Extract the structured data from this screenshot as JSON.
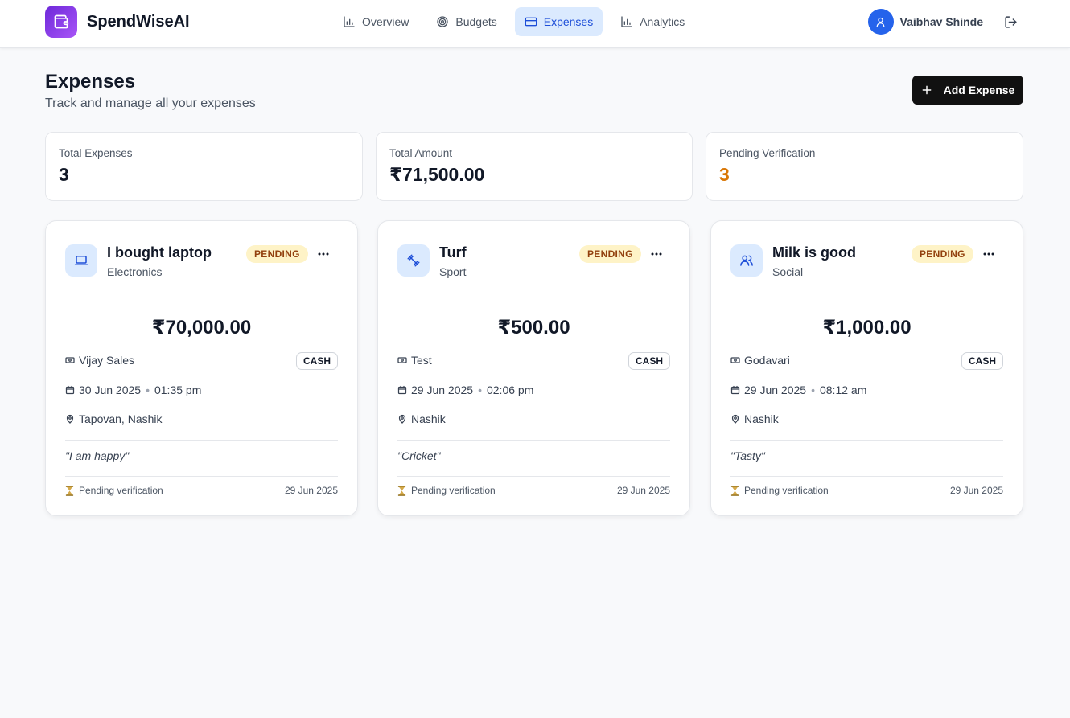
{
  "app": {
    "name": "SpendWiseAI"
  },
  "nav": {
    "items": [
      {
        "label": "Overview",
        "icon": "bar-chart-icon"
      },
      {
        "label": "Budgets",
        "icon": "target-icon"
      },
      {
        "label": "Expenses",
        "icon": "credit-card-icon",
        "active": true
      },
      {
        "label": "Analytics",
        "icon": "bar-chart-icon"
      }
    ]
  },
  "user": {
    "name": "Vaibhav Shinde"
  },
  "header": {
    "title": "Expenses",
    "subtitle": "Track and manage all your expenses",
    "add_button": "Add Expense"
  },
  "stats": [
    {
      "label": "Total Expenses",
      "value": "3"
    },
    {
      "label": "Total Amount",
      "value": "₹71,500.00"
    },
    {
      "label": "Pending Verification",
      "value": "3"
    }
  ],
  "colors": {
    "accent": "#1d4ed8",
    "pending_bg": "#fef3c7",
    "pending_text": "#92400e",
    "warning": "#d97706"
  },
  "expenses": [
    {
      "title": "I bought laptop",
      "category": "Electronics",
      "category_icon": "laptop-icon",
      "status": "PENDING",
      "amount": "₹70,000.00",
      "merchant": "Vijay Sales",
      "payment": "CASH",
      "date": "30 Jun 2025",
      "time": "01:35 pm",
      "location": "Tapovan, Nashik",
      "note": "\"I am happy\"",
      "verification": "Pending verification",
      "created": "29 Jun 2025"
    },
    {
      "title": "Turf",
      "category": "Sport",
      "category_icon": "dumbbell-icon",
      "status": "PENDING",
      "amount": "₹500.00",
      "merchant": "Test",
      "payment": "CASH",
      "date": "29 Jun 2025",
      "time": "02:06 pm",
      "location": "Nashik",
      "note": "\"Cricket\"",
      "verification": "Pending verification",
      "created": "29 Jun 2025"
    },
    {
      "title": "Milk is good",
      "category": "Social",
      "category_icon": "users-icon",
      "status": "PENDING",
      "amount": "₹1,000.00",
      "merchant": "Godavari",
      "payment": "CASH",
      "date": "29 Jun 2025",
      "time": "08:12 am",
      "location": "Nashik",
      "note": "\"Tasty\"",
      "verification": "Pending verification",
      "created": "29 Jun 2025"
    }
  ]
}
